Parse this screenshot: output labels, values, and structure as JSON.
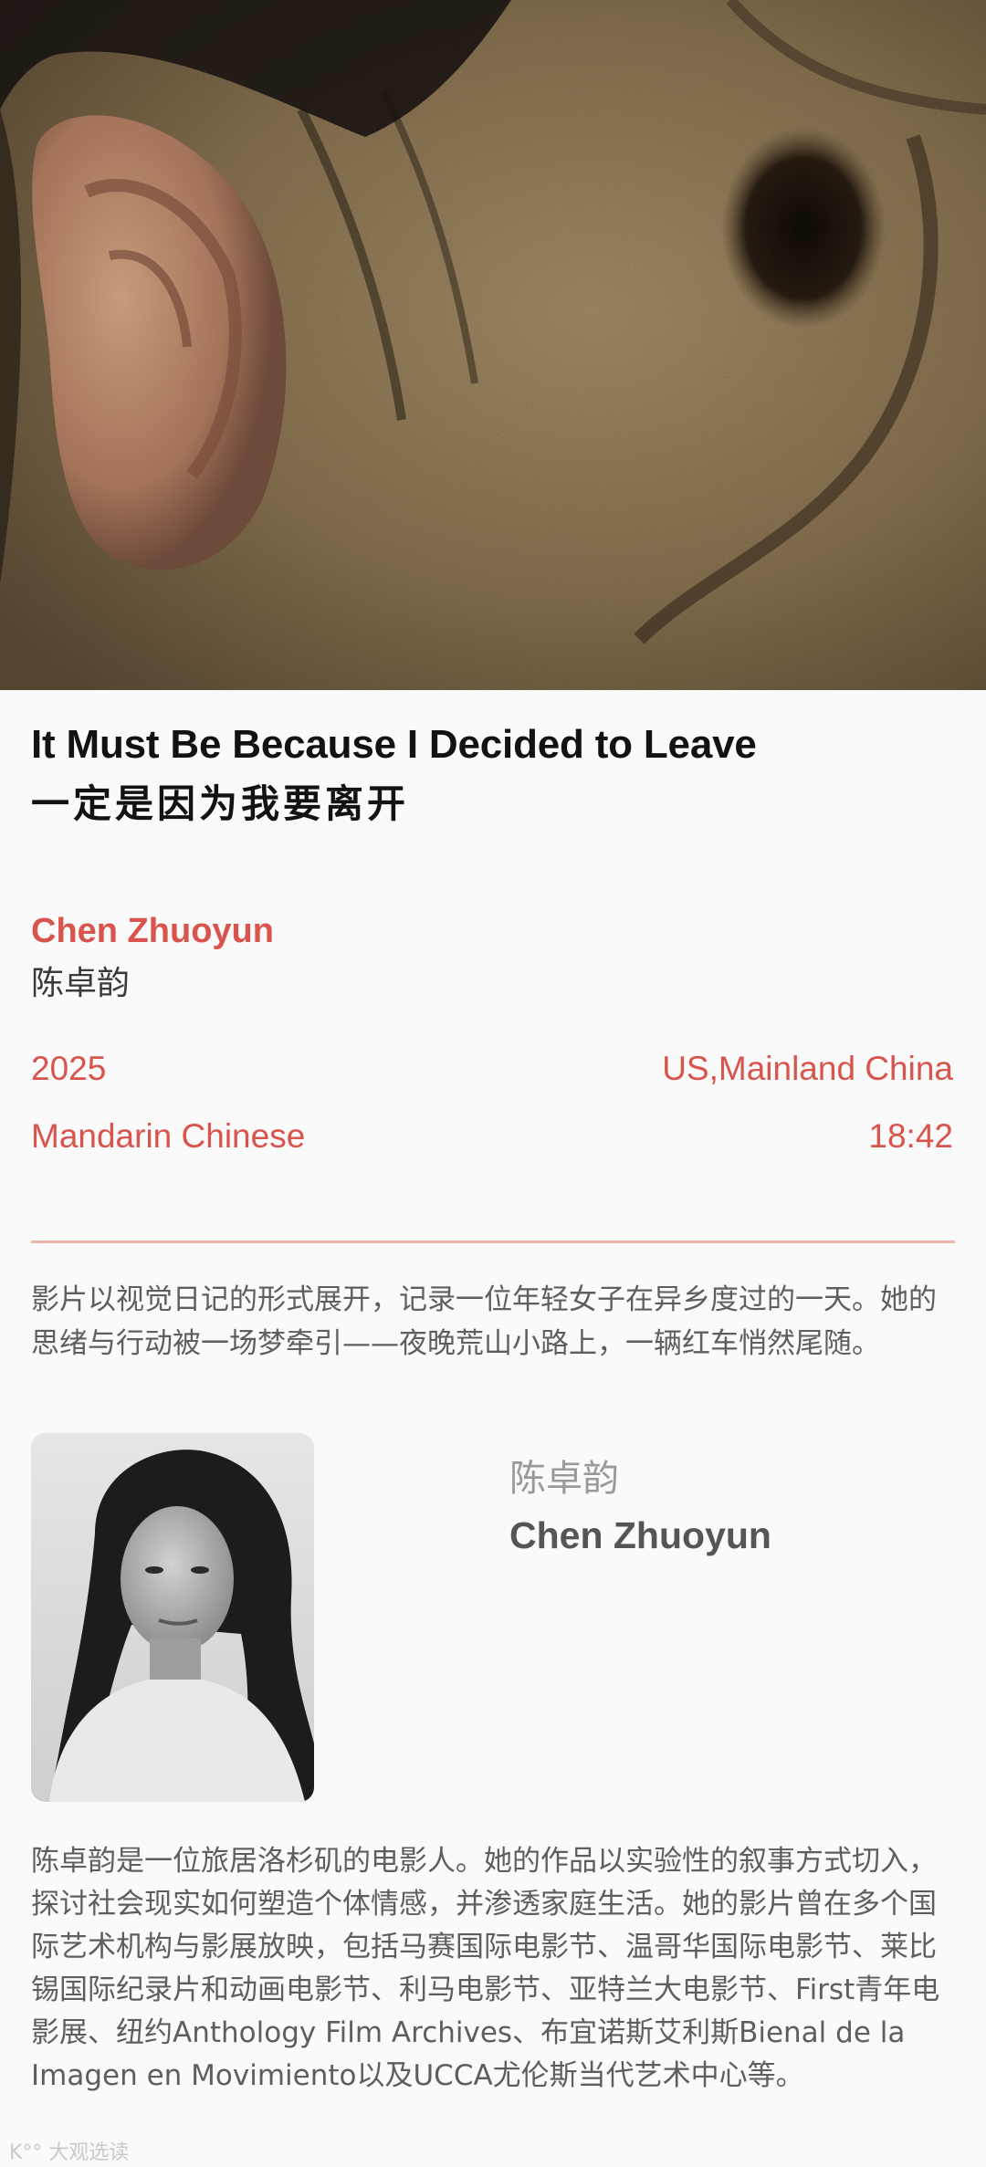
{
  "film": {
    "title_en": "It Must Be Because I Decided to Leave",
    "title_zh": "一定是因为我要离开"
  },
  "director": {
    "name_en": "Chen Zhuoyun",
    "name_zh": "陈卓韵"
  },
  "meta": {
    "year": "2025",
    "country": "US,Mainland China",
    "language": "Mandarin Chinese",
    "duration": "18:42"
  },
  "synopsis": "影片以视觉日记的形式展开，记录一位年轻女子在异乡度过的一天。她的思绪与行动被一场梦牵引——夜晚荒山小路上，一辆红车悄然尾随。",
  "bio": {
    "name_zh": "陈卓韵",
    "name_en": "Chen Zhuoyun",
    "text": "陈卓韵是一位旅居洛杉矶的电影人。她的作品以实验性的叙事方式切入，探讨社会现实如何塑造个体情感，并渗透家庭生活。她的影片曾在多个国际艺术机构与影展放映，包括马赛国际电影节、温哥华国际电影节、莱比锡国际纪录片和动画电影节、利马电影节、亚特兰大电影节、First青年电影展、纽约Anthology Film Archives、布宜诺斯艾利斯Bienal de la Imagen en Movimiento以及UCCA尤伦斯当代艺术中心等。"
  },
  "watermark": "K°° 大观选读",
  "colors": {
    "accent": "#d8544c",
    "divider": "#ecb4ab",
    "body_text": "#5e5e5e",
    "background": "#fafafa"
  }
}
